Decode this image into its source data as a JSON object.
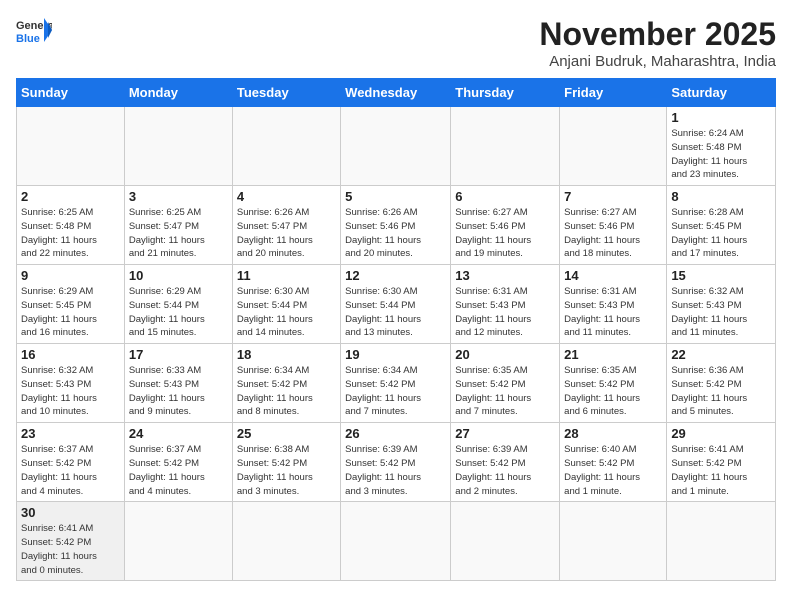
{
  "header": {
    "month_title": "November 2025",
    "location": "Anjani Budruk, Maharashtra, India",
    "logo_general": "General",
    "logo_blue": "Blue"
  },
  "days_of_week": [
    "Sunday",
    "Monday",
    "Tuesday",
    "Wednesday",
    "Thursday",
    "Friday",
    "Saturday"
  ],
  "weeks": [
    [
      {
        "day": null,
        "info": ""
      },
      {
        "day": null,
        "info": ""
      },
      {
        "day": null,
        "info": ""
      },
      {
        "day": null,
        "info": ""
      },
      {
        "day": null,
        "info": ""
      },
      {
        "day": null,
        "info": ""
      },
      {
        "day": "1",
        "info": "Sunrise: 6:24 AM\nSunset: 5:48 PM\nDaylight: 11 hours\nand 23 minutes."
      }
    ],
    [
      {
        "day": "2",
        "info": "Sunrise: 6:25 AM\nSunset: 5:48 PM\nDaylight: 11 hours\nand 22 minutes."
      },
      {
        "day": "3",
        "info": "Sunrise: 6:25 AM\nSunset: 5:47 PM\nDaylight: 11 hours\nand 21 minutes."
      },
      {
        "day": "4",
        "info": "Sunrise: 6:26 AM\nSunset: 5:47 PM\nDaylight: 11 hours\nand 20 minutes."
      },
      {
        "day": "5",
        "info": "Sunrise: 6:26 AM\nSunset: 5:46 PM\nDaylight: 11 hours\nand 20 minutes."
      },
      {
        "day": "6",
        "info": "Sunrise: 6:27 AM\nSunset: 5:46 PM\nDaylight: 11 hours\nand 19 minutes."
      },
      {
        "day": "7",
        "info": "Sunrise: 6:27 AM\nSunset: 5:46 PM\nDaylight: 11 hours\nand 18 minutes."
      },
      {
        "day": "8",
        "info": "Sunrise: 6:28 AM\nSunset: 5:45 PM\nDaylight: 11 hours\nand 17 minutes."
      }
    ],
    [
      {
        "day": "9",
        "info": "Sunrise: 6:29 AM\nSunset: 5:45 PM\nDaylight: 11 hours\nand 16 minutes."
      },
      {
        "day": "10",
        "info": "Sunrise: 6:29 AM\nSunset: 5:44 PM\nDaylight: 11 hours\nand 15 minutes."
      },
      {
        "day": "11",
        "info": "Sunrise: 6:30 AM\nSunset: 5:44 PM\nDaylight: 11 hours\nand 14 minutes."
      },
      {
        "day": "12",
        "info": "Sunrise: 6:30 AM\nSunset: 5:44 PM\nDaylight: 11 hours\nand 13 minutes."
      },
      {
        "day": "13",
        "info": "Sunrise: 6:31 AM\nSunset: 5:43 PM\nDaylight: 11 hours\nand 12 minutes."
      },
      {
        "day": "14",
        "info": "Sunrise: 6:31 AM\nSunset: 5:43 PM\nDaylight: 11 hours\nand 11 minutes."
      },
      {
        "day": "15",
        "info": "Sunrise: 6:32 AM\nSunset: 5:43 PM\nDaylight: 11 hours\nand 11 minutes."
      }
    ],
    [
      {
        "day": "16",
        "info": "Sunrise: 6:32 AM\nSunset: 5:43 PM\nDaylight: 11 hours\nand 10 minutes."
      },
      {
        "day": "17",
        "info": "Sunrise: 6:33 AM\nSunset: 5:43 PM\nDaylight: 11 hours\nand 9 minutes."
      },
      {
        "day": "18",
        "info": "Sunrise: 6:34 AM\nSunset: 5:42 PM\nDaylight: 11 hours\nand 8 minutes."
      },
      {
        "day": "19",
        "info": "Sunrise: 6:34 AM\nSunset: 5:42 PM\nDaylight: 11 hours\nand 7 minutes."
      },
      {
        "day": "20",
        "info": "Sunrise: 6:35 AM\nSunset: 5:42 PM\nDaylight: 11 hours\nand 7 minutes."
      },
      {
        "day": "21",
        "info": "Sunrise: 6:35 AM\nSunset: 5:42 PM\nDaylight: 11 hours\nand 6 minutes."
      },
      {
        "day": "22",
        "info": "Sunrise: 6:36 AM\nSunset: 5:42 PM\nDaylight: 11 hours\nand 5 minutes."
      }
    ],
    [
      {
        "day": "23",
        "info": "Sunrise: 6:37 AM\nSunset: 5:42 PM\nDaylight: 11 hours\nand 4 minutes."
      },
      {
        "day": "24",
        "info": "Sunrise: 6:37 AM\nSunset: 5:42 PM\nDaylight: 11 hours\nand 4 minutes."
      },
      {
        "day": "25",
        "info": "Sunrise: 6:38 AM\nSunset: 5:42 PM\nDaylight: 11 hours\nand 3 minutes."
      },
      {
        "day": "26",
        "info": "Sunrise: 6:39 AM\nSunset: 5:42 PM\nDaylight: 11 hours\nand 3 minutes."
      },
      {
        "day": "27",
        "info": "Sunrise: 6:39 AM\nSunset: 5:42 PM\nDaylight: 11 hours\nand 2 minutes."
      },
      {
        "day": "28",
        "info": "Sunrise: 6:40 AM\nSunset: 5:42 PM\nDaylight: 11 hours\nand 1 minute."
      },
      {
        "day": "29",
        "info": "Sunrise: 6:41 AM\nSunset: 5:42 PM\nDaylight: 11 hours\nand 1 minute."
      }
    ],
    [
      {
        "day": "30",
        "info": "Sunrise: 6:41 AM\nSunset: 5:42 PM\nDaylight: 11 hours\nand 0 minutes."
      },
      {
        "day": null,
        "info": ""
      },
      {
        "day": null,
        "info": ""
      },
      {
        "day": null,
        "info": ""
      },
      {
        "day": null,
        "info": ""
      },
      {
        "day": null,
        "info": ""
      },
      {
        "day": null,
        "info": ""
      }
    ]
  ]
}
